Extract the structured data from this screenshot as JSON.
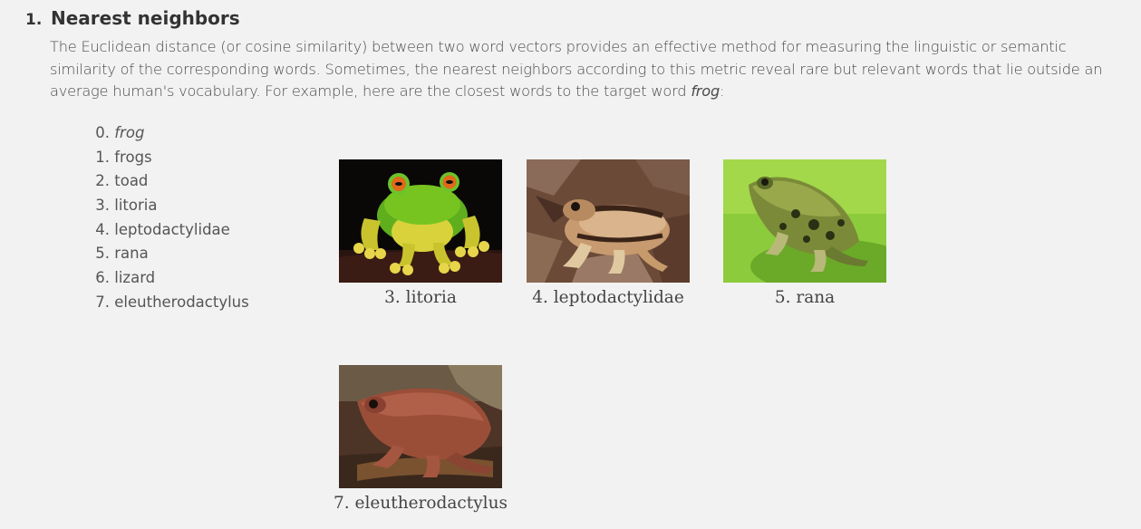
{
  "section": {
    "number": "1.",
    "title": "Nearest neighbors"
  },
  "intro": {
    "text_before": "The Euclidean distance (or cosine similarity) between two word vectors provides an effective method for measuring the linguistic or semantic similarity of the corresponding words. Sometimes, the nearest neighbors according to this metric reveal rare but relevant words that lie outside an average human's vocabulary. For example, here are the closest words to the target word ",
    "target_word": "frog",
    "text_after": ":"
  },
  "neighbors": [
    {
      "index": "0.",
      "word": "frog"
    },
    {
      "index": "1.",
      "word": "frogs"
    },
    {
      "index": "2.",
      "word": "toad"
    },
    {
      "index": "3.",
      "word": "litoria"
    },
    {
      "index": "4.",
      "word": "leptodactylidae"
    },
    {
      "index": "5.",
      "word": "rana"
    },
    {
      "index": "6.",
      "word": "lizard"
    },
    {
      "index": "7.",
      "word": "eleutherodactylus"
    }
  ],
  "figures": {
    "litoria": {
      "caption": "3. litoria",
      "image": "green-tree-frog-photo"
    },
    "leptodactylidae": {
      "caption": "4. leptodactylidae",
      "image": "brown-striped-frog-photo"
    },
    "rana": {
      "caption": "5. rana",
      "image": "spotted-green-frog-photo"
    },
    "eleutherodactylus": {
      "caption": "7. eleutherodactylus",
      "image": "reddish-brown-frog-photo"
    }
  }
}
